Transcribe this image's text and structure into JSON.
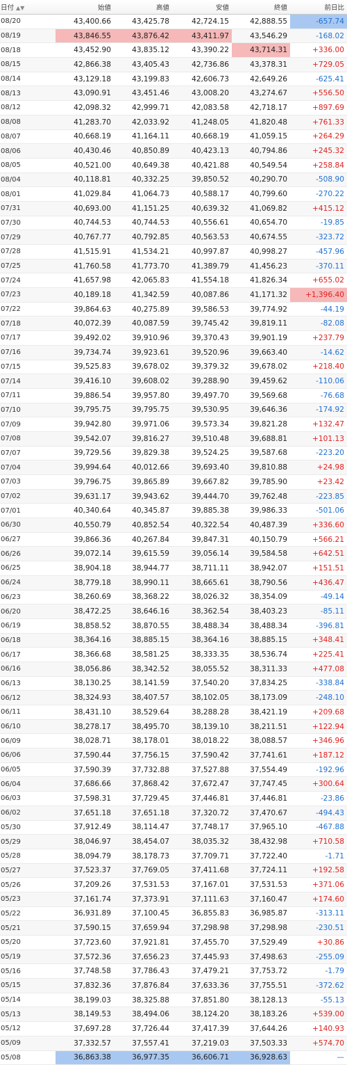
{
  "header": {
    "date": "日付",
    "open": "始値",
    "high": "高値",
    "low": "安値",
    "close": "終値",
    "change": "前日比"
  },
  "rows": [
    {
      "date": "08/20",
      "open": "43,400.66",
      "high": "43,425.78",
      "low": "42,724.15",
      "close": "42,888.55",
      "change": "-657.74",
      "dir": "down",
      "hl": [
        "change-blue"
      ]
    },
    {
      "date": "08/19",
      "open": "43,846.55",
      "high": "43,876.42",
      "low": "43,411.97",
      "close": "43,546.29",
      "change": "-168.02",
      "dir": "down",
      "hl": [
        "open-red",
        "high-red",
        "low-red"
      ]
    },
    {
      "date": "08/18",
      "open": "43,452.90",
      "high": "43,835.12",
      "low": "43,390.22",
      "close": "43,714.31",
      "change": "+336.00",
      "dir": "up",
      "hl": [
        "close-red"
      ]
    },
    {
      "date": "08/15",
      "open": "42,866.38",
      "high": "43,405.43",
      "low": "42,736.86",
      "close": "43,378.31",
      "change": "+729.05",
      "dir": "up",
      "hl": []
    },
    {
      "date": "08/14",
      "open": "43,129.18",
      "high": "43,199.83",
      "low": "42,606.73",
      "close": "42,649.26",
      "change": "-625.41",
      "dir": "down",
      "hl": []
    },
    {
      "date": "08/13",
      "open": "43,090.91",
      "high": "43,451.46",
      "low": "43,008.20",
      "close": "43,274.67",
      "change": "+556.50",
      "dir": "up",
      "hl": []
    },
    {
      "date": "08/12",
      "open": "42,098.32",
      "high": "42,999.71",
      "low": "42,083.58",
      "close": "42,718.17",
      "change": "+897.69",
      "dir": "up",
      "hl": []
    },
    {
      "date": "08/08",
      "open": "41,283.70",
      "high": "42,033.92",
      "low": "41,248.05",
      "close": "41,820.48",
      "change": "+761.33",
      "dir": "up",
      "hl": []
    },
    {
      "date": "08/07",
      "open": "40,668.19",
      "high": "41,164.11",
      "low": "40,668.19",
      "close": "41,059.15",
      "change": "+264.29",
      "dir": "up",
      "hl": []
    },
    {
      "date": "08/06",
      "open": "40,430.46",
      "high": "40,850.89",
      "low": "40,423.13",
      "close": "40,794.86",
      "change": "+245.32",
      "dir": "up",
      "hl": []
    },
    {
      "date": "08/05",
      "open": "40,521.00",
      "high": "40,649.38",
      "low": "40,421.88",
      "close": "40,549.54",
      "change": "+258.84",
      "dir": "up",
      "hl": []
    },
    {
      "date": "08/04",
      "open": "40,118.81",
      "high": "40,332.25",
      "low": "39,850.52",
      "close": "40,290.70",
      "change": "-508.90",
      "dir": "down",
      "hl": []
    },
    {
      "date": "08/01",
      "open": "41,029.84",
      "high": "41,064.73",
      "low": "40,588.17",
      "close": "40,799.60",
      "change": "-270.22",
      "dir": "down",
      "hl": []
    },
    {
      "date": "07/31",
      "open": "40,693.00",
      "high": "41,151.25",
      "low": "40,639.32",
      "close": "41,069.82",
      "change": "+415.12",
      "dir": "up",
      "hl": []
    },
    {
      "date": "07/30",
      "open": "40,744.53",
      "high": "40,744.53",
      "low": "40,556.61",
      "close": "40,654.70",
      "change": "-19.85",
      "dir": "down",
      "hl": []
    },
    {
      "date": "07/29",
      "open": "40,767.77",
      "high": "40,792.85",
      "low": "40,563.53",
      "close": "40,674.55",
      "change": "-323.72",
      "dir": "down",
      "hl": []
    },
    {
      "date": "07/28",
      "open": "41,515.91",
      "high": "41,534.21",
      "low": "40,997.87",
      "close": "40,998.27",
      "change": "-457.96",
      "dir": "down",
      "hl": []
    },
    {
      "date": "07/25",
      "open": "41,760.58",
      "high": "41,773.70",
      "low": "41,389.79",
      "close": "41,456.23",
      "change": "-370.11",
      "dir": "down",
      "hl": []
    },
    {
      "date": "07/24",
      "open": "41,657.98",
      "high": "42,065.83",
      "low": "41,554.18",
      "close": "41,826.34",
      "change": "+655.02",
      "dir": "up",
      "hl": []
    },
    {
      "date": "07/23",
      "open": "40,189.18",
      "high": "41,342.59",
      "low": "40,087.86",
      "close": "41,171.32",
      "change": "+1,396.40",
      "dir": "up",
      "hl": [
        "change-red"
      ]
    },
    {
      "date": "07/22",
      "open": "39,864.63",
      "high": "40,275.89",
      "low": "39,586.53",
      "close": "39,774.92",
      "change": "-44.19",
      "dir": "down",
      "hl": []
    },
    {
      "date": "07/18",
      "open": "40,072.39",
      "high": "40,087.59",
      "low": "39,745.42",
      "close": "39,819.11",
      "change": "-82.08",
      "dir": "down",
      "hl": []
    },
    {
      "date": "07/17",
      "open": "39,492.02",
      "high": "39,910.96",
      "low": "39,370.43",
      "close": "39,901.19",
      "change": "+237.79",
      "dir": "up",
      "hl": []
    },
    {
      "date": "07/16",
      "open": "39,734.74",
      "high": "39,923.61",
      "low": "39,520.96",
      "close": "39,663.40",
      "change": "-14.62",
      "dir": "down",
      "hl": []
    },
    {
      "date": "07/15",
      "open": "39,525.83",
      "high": "39,678.02",
      "low": "39,379.32",
      "close": "39,678.02",
      "change": "+218.40",
      "dir": "up",
      "hl": []
    },
    {
      "date": "07/14",
      "open": "39,416.10",
      "high": "39,608.02",
      "low": "39,288.90",
      "close": "39,459.62",
      "change": "-110.06",
      "dir": "down",
      "hl": []
    },
    {
      "date": "07/11",
      "open": "39,886.54",
      "high": "39,957.80",
      "low": "39,497.70",
      "close": "39,569.68",
      "change": "-76.68",
      "dir": "down",
      "hl": []
    },
    {
      "date": "07/10",
      "open": "39,795.75",
      "high": "39,795.75",
      "low": "39,530.95",
      "close": "39,646.36",
      "change": "-174.92",
      "dir": "down",
      "hl": []
    },
    {
      "date": "07/09",
      "open": "39,942.80",
      "high": "39,971.06",
      "low": "39,573.34",
      "close": "39,821.28",
      "change": "+132.47",
      "dir": "up",
      "hl": []
    },
    {
      "date": "07/08",
      "open": "39,542.07",
      "high": "39,816.27",
      "low": "39,510.48",
      "close": "39,688.81",
      "change": "+101.13",
      "dir": "up",
      "hl": []
    },
    {
      "date": "07/07",
      "open": "39,729.56",
      "high": "39,829.38",
      "low": "39,524.25",
      "close": "39,587.68",
      "change": "-223.20",
      "dir": "down",
      "hl": []
    },
    {
      "date": "07/04",
      "open": "39,994.64",
      "high": "40,012.66",
      "low": "39,693.40",
      "close": "39,810.88",
      "change": "+24.98",
      "dir": "up",
      "hl": []
    },
    {
      "date": "07/03",
      "open": "39,796.75",
      "high": "39,865.89",
      "low": "39,667.82",
      "close": "39,785.90",
      "change": "+23.42",
      "dir": "up",
      "hl": []
    },
    {
      "date": "07/02",
      "open": "39,631.17",
      "high": "39,943.62",
      "low": "39,444.70",
      "close": "39,762.48",
      "change": "-223.85",
      "dir": "down",
      "hl": []
    },
    {
      "date": "07/01",
      "open": "40,340.64",
      "high": "40,345.87",
      "low": "39,885.38",
      "close": "39,986.33",
      "change": "-501.06",
      "dir": "down",
      "hl": []
    },
    {
      "date": "06/30",
      "open": "40,550.79",
      "high": "40,852.54",
      "low": "40,322.54",
      "close": "40,487.39",
      "change": "+336.60",
      "dir": "up",
      "hl": []
    },
    {
      "date": "06/27",
      "open": "39,866.36",
      "high": "40,267.84",
      "low": "39,847.31",
      "close": "40,150.79",
      "change": "+566.21",
      "dir": "up",
      "hl": []
    },
    {
      "date": "06/26",
      "open": "39,072.14",
      "high": "39,615.59",
      "low": "39,056.14",
      "close": "39,584.58",
      "change": "+642.51",
      "dir": "up",
      "hl": []
    },
    {
      "date": "06/25",
      "open": "38,904.18",
      "high": "38,944.77",
      "low": "38,711.11",
      "close": "38,942.07",
      "change": "+151.51",
      "dir": "up",
      "hl": []
    },
    {
      "date": "06/24",
      "open": "38,779.18",
      "high": "38,990.11",
      "low": "38,665.61",
      "close": "38,790.56",
      "change": "+436.47",
      "dir": "up",
      "hl": []
    },
    {
      "date": "06/23",
      "open": "38,260.69",
      "high": "38,368.22",
      "low": "38,026.32",
      "close": "38,354.09",
      "change": "-49.14",
      "dir": "down",
      "hl": []
    },
    {
      "date": "06/20",
      "open": "38,472.25",
      "high": "38,646.16",
      "low": "38,362.54",
      "close": "38,403.23",
      "change": "-85.11",
      "dir": "down",
      "hl": []
    },
    {
      "date": "06/19",
      "open": "38,858.52",
      "high": "38,870.55",
      "low": "38,488.34",
      "close": "38,488.34",
      "change": "-396.81",
      "dir": "down",
      "hl": []
    },
    {
      "date": "06/18",
      "open": "38,364.16",
      "high": "38,885.15",
      "low": "38,364.16",
      "close": "38,885.15",
      "change": "+348.41",
      "dir": "up",
      "hl": []
    },
    {
      "date": "06/17",
      "open": "38,366.68",
      "high": "38,581.25",
      "low": "38,333.35",
      "close": "38,536.74",
      "change": "+225.41",
      "dir": "up",
      "hl": []
    },
    {
      "date": "06/16",
      "open": "38,056.86",
      "high": "38,342.52",
      "low": "38,055.52",
      "close": "38,311.33",
      "change": "+477.08",
      "dir": "up",
      "hl": []
    },
    {
      "date": "06/13",
      "open": "38,130.25",
      "high": "38,141.59",
      "low": "37,540.20",
      "close": "37,834.25",
      "change": "-338.84",
      "dir": "down",
      "hl": []
    },
    {
      "date": "06/12",
      "open": "38,324.93",
      "high": "38,407.57",
      "low": "38,102.05",
      "close": "38,173.09",
      "change": "-248.10",
      "dir": "down",
      "hl": []
    },
    {
      "date": "06/11",
      "open": "38,431.10",
      "high": "38,529.64",
      "low": "38,288.28",
      "close": "38,421.19",
      "change": "+209.68",
      "dir": "up",
      "hl": []
    },
    {
      "date": "06/10",
      "open": "38,278.17",
      "high": "38,495.70",
      "low": "38,139.10",
      "close": "38,211.51",
      "change": "+122.94",
      "dir": "up",
      "hl": []
    },
    {
      "date": "06/09",
      "open": "38,028.71",
      "high": "38,178.01",
      "low": "38,018.22",
      "close": "38,088.57",
      "change": "+346.96",
      "dir": "up",
      "hl": []
    },
    {
      "date": "06/06",
      "open": "37,590.44",
      "high": "37,756.15",
      "low": "37,590.42",
      "close": "37,741.61",
      "change": "+187.12",
      "dir": "up",
      "hl": []
    },
    {
      "date": "06/05",
      "open": "37,590.39",
      "high": "37,732.88",
      "low": "37,527.88",
      "close": "37,554.49",
      "change": "-192.96",
      "dir": "down",
      "hl": []
    },
    {
      "date": "06/04",
      "open": "37,686.66",
      "high": "37,868.42",
      "low": "37,672.47",
      "close": "37,747.45",
      "change": "+300.64",
      "dir": "up",
      "hl": []
    },
    {
      "date": "06/03",
      "open": "37,598.31",
      "high": "37,729.45",
      "low": "37,446.81",
      "close": "37,446.81",
      "change": "-23.86",
      "dir": "down",
      "hl": []
    },
    {
      "date": "06/02",
      "open": "37,651.18",
      "high": "37,651.18",
      "low": "37,320.72",
      "close": "37,470.67",
      "change": "-494.43",
      "dir": "down",
      "hl": []
    },
    {
      "date": "05/30",
      "open": "37,912.49",
      "high": "38,114.47",
      "low": "37,748.17",
      "close": "37,965.10",
      "change": "-467.88",
      "dir": "down",
      "hl": []
    },
    {
      "date": "05/29",
      "open": "38,046.97",
      "high": "38,454.07",
      "low": "38,035.32",
      "close": "38,432.98",
      "change": "+710.58",
      "dir": "up",
      "hl": []
    },
    {
      "date": "05/28",
      "open": "38,094.79",
      "high": "38,178.73",
      "low": "37,709.71",
      "close": "37,722.40",
      "change": "-1.71",
      "dir": "down",
      "hl": []
    },
    {
      "date": "05/27",
      "open": "37,523.37",
      "high": "37,769.05",
      "low": "37,411.68",
      "close": "37,724.11",
      "change": "+192.58",
      "dir": "up",
      "hl": []
    },
    {
      "date": "05/26",
      "open": "37,209.26",
      "high": "37,531.53",
      "low": "37,167.01",
      "close": "37,531.53",
      "change": "+371.06",
      "dir": "up",
      "hl": []
    },
    {
      "date": "05/23",
      "open": "37,161.74",
      "high": "37,373.91",
      "low": "37,111.63",
      "close": "37,160.47",
      "change": "+174.60",
      "dir": "up",
      "hl": []
    },
    {
      "date": "05/22",
      "open": "36,931.89",
      "high": "37,100.45",
      "low": "36,855.83",
      "close": "36,985.87",
      "change": "-313.11",
      "dir": "down",
      "hl": []
    },
    {
      "date": "05/21",
      "open": "37,590.15",
      "high": "37,659.94",
      "low": "37,298.98",
      "close": "37,298.98",
      "change": "-230.51",
      "dir": "down",
      "hl": []
    },
    {
      "date": "05/20",
      "open": "37,723.60",
      "high": "37,921.81",
      "low": "37,455.70",
      "close": "37,529.49",
      "change": "+30.86",
      "dir": "up",
      "hl": []
    },
    {
      "date": "05/19",
      "open": "37,572.36",
      "high": "37,656.23",
      "low": "37,445.93",
      "close": "37,498.63",
      "change": "-255.09",
      "dir": "down",
      "hl": []
    },
    {
      "date": "05/16",
      "open": "37,748.58",
      "high": "37,786.43",
      "low": "37,479.21",
      "close": "37,753.72",
      "change": "-1.79",
      "dir": "down",
      "hl": []
    },
    {
      "date": "05/15",
      "open": "37,832.36",
      "high": "37,876.84",
      "low": "37,633.36",
      "close": "37,755.51",
      "change": "-372.62",
      "dir": "down",
      "hl": []
    },
    {
      "date": "05/14",
      "open": "38,199.03",
      "high": "38,325.88",
      "low": "37,851.80",
      "close": "38,128.13",
      "change": "-55.13",
      "dir": "down",
      "hl": []
    },
    {
      "date": "05/13",
      "open": "38,149.53",
      "high": "38,494.06",
      "low": "38,124.20",
      "close": "38,183.26",
      "change": "+539.00",
      "dir": "up",
      "hl": []
    },
    {
      "date": "05/12",
      "open": "37,697.28",
      "high": "37,726.44",
      "low": "37,417.39",
      "close": "37,644.26",
      "change": "+140.93",
      "dir": "up",
      "hl": []
    },
    {
      "date": "05/09",
      "open": "37,332.57",
      "high": "37,557.41",
      "low": "37,219.03",
      "close": "37,503.33",
      "change": "+574.70",
      "dir": "up",
      "hl": []
    },
    {
      "date": "05/08",
      "open": "36,863.38",
      "high": "36,977.35",
      "low": "36,606.71",
      "close": "36,928.63",
      "change": "—",
      "dir": "flat",
      "hl": [
        "open-blue",
        "high-blue",
        "low-blue",
        "close-blue"
      ]
    }
  ],
  "colors": {
    "up": "#e0201f",
    "down": "#1f6fd3",
    "highlight_red": "#f6b8b8",
    "highlight_blue": "#a9c8f1"
  }
}
